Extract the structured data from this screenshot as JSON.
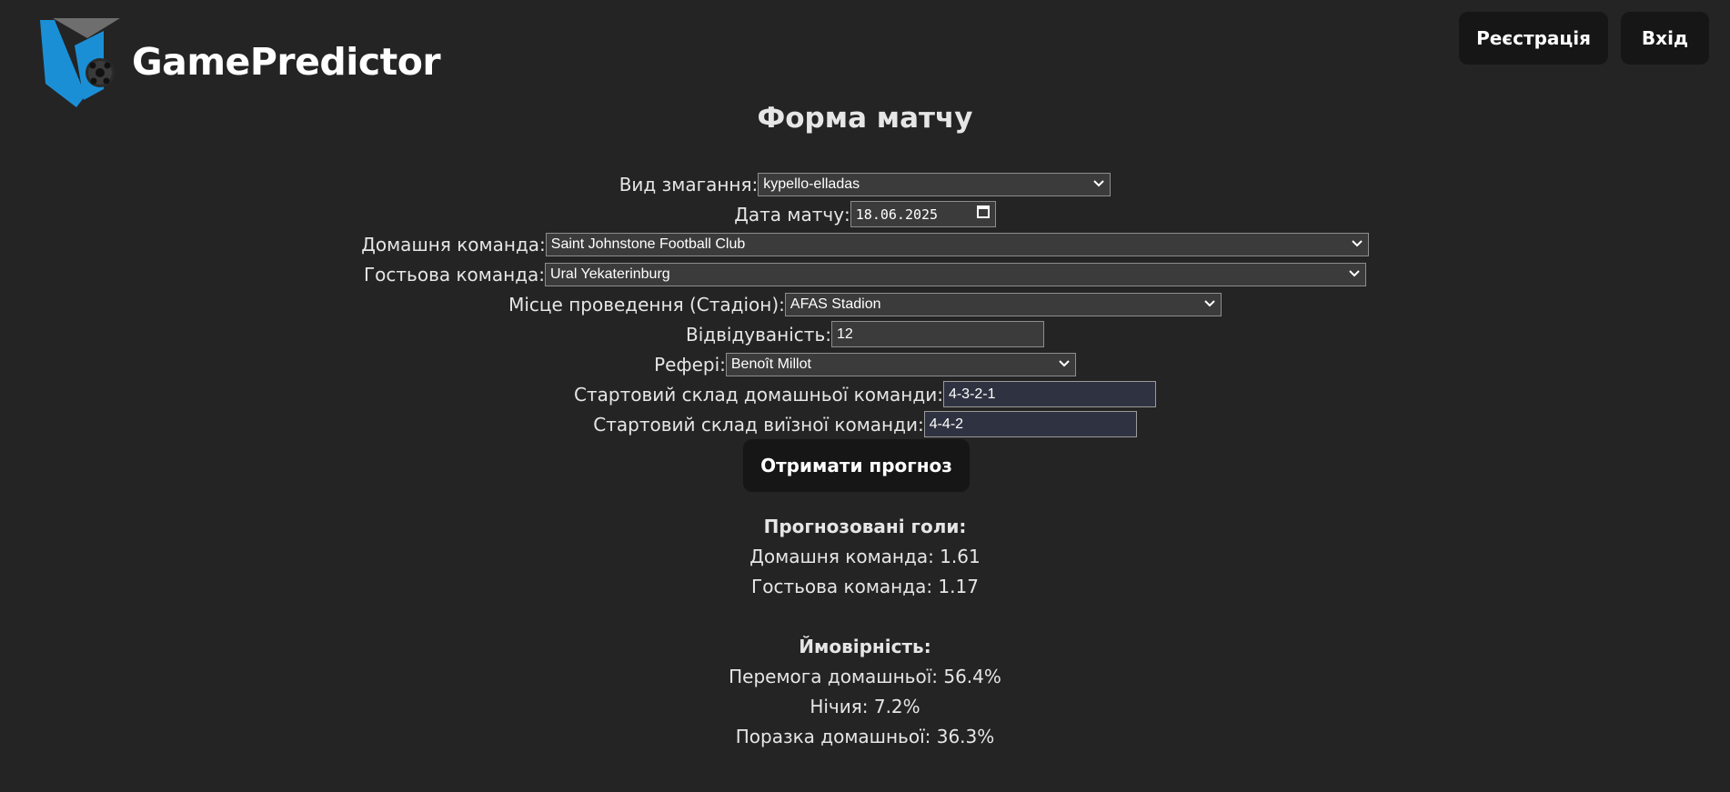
{
  "header": {
    "brand": "GamePredictor",
    "register_label": "Реєстрація",
    "login_label": "Вхід"
  },
  "page_title": "Форма матчу",
  "form": {
    "competition": {
      "label": "Вид змагання:",
      "value": "kypello-elladas"
    },
    "date": {
      "label": "Дата матчу:",
      "value": "18.06.2025"
    },
    "home_team": {
      "label": "Домашня команда:",
      "value": "Saint Johnstone Football Club"
    },
    "away_team": {
      "label": "Гостьова команда:",
      "value": "Ural Yekaterinburg"
    },
    "venue": {
      "label": "Місце проведення (Стадіон):",
      "value": "AFAS Stadion"
    },
    "attendance": {
      "label": "Відвідуваність:",
      "value": "12"
    },
    "referee": {
      "label": "Рефері:",
      "value": "Benoît Millot"
    },
    "home_lineup": {
      "label": "Стартовий склад домашньої команди:",
      "value": "4-3-2-1"
    },
    "away_lineup": {
      "label": "Стартовий склад виїзної команди:",
      "value": "4-4-2"
    },
    "submit_label": "Отримати прогноз"
  },
  "results": {
    "goals_title": "Прогнозовані голи:",
    "home_goals": "Домашня команда: 1.61",
    "away_goals": "Гостьова команда: 1.17",
    "prob_title": "Ймовірність:",
    "home_win": "Перемога домашньої: 56.4%",
    "draw": "Нічия: 7.2%",
    "home_loss": "Поразка домашньої: 36.3%"
  },
  "colors": {
    "background": "#242424",
    "button": "#161616",
    "logo_blue": "#1b8fd6",
    "logo_grey": "#6e6e6e"
  },
  "icons": {
    "logo": "shield-ball-logo",
    "dropdown": "chevron-down-icon",
    "calendar": "calendar-icon"
  }
}
